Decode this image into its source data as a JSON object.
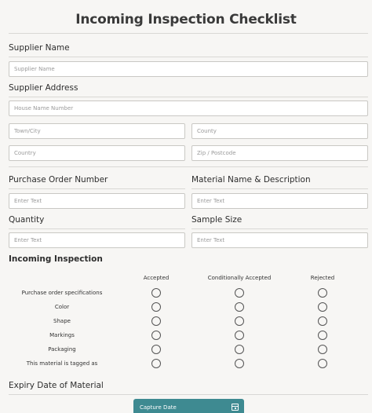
{
  "form": {
    "title": "Incoming Inspection Checklist",
    "supplier_name": {
      "label": "Supplier Name",
      "placeholder": "Supplier Name"
    },
    "supplier_address": {
      "label": "Supplier Address",
      "house_placeholder": "House Name Number",
      "town_placeholder": "Town/City",
      "county_placeholder": "County",
      "country_placeholder": "Country",
      "zip_placeholder": "Zip / Postcode"
    },
    "purchase_order": {
      "label": "Purchase Order Number",
      "placeholder": "Enter Text"
    },
    "material_name": {
      "label": "Material Name & Description",
      "placeholder": "Enter Text"
    },
    "quantity": {
      "label": "Quantity",
      "placeholder": "Enter Text"
    },
    "sample_size": {
      "label": "Sample Size",
      "placeholder": "Enter Text"
    },
    "inspection": {
      "title": "Incoming Inspection",
      "columns": [
        "Accepted",
        "Conditionally Accepted",
        "Rejected"
      ],
      "rows": [
        "Purchase order specifications",
        "Color",
        "Shape",
        "Markings",
        "Packaging",
        "This material is tagged as"
      ]
    },
    "expiry": {
      "label": "Expiry Date of Material",
      "button_label": "Capture Date",
      "icon": "calendar-icon"
    }
  },
  "colors": {
    "background": "#f7f6f4",
    "button": "#3e8a91",
    "field_border": "#c9c8c4"
  }
}
